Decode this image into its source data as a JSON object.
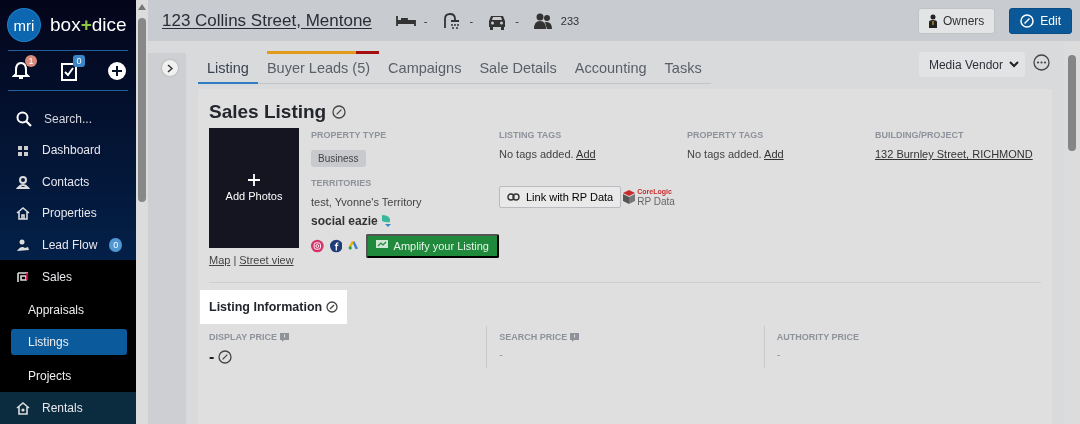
{
  "brand": {
    "logo": "mri",
    "before": "box",
    "joiner": "+",
    "after": "dice"
  },
  "quick_actions": [
    {
      "kind": "bell",
      "badge": "1"
    },
    {
      "kind": "tasks",
      "badge": "0"
    },
    {
      "kind": "add"
    }
  ],
  "search": {
    "placeholder": "Search..."
  },
  "nav": [
    {
      "kind": "dashboard",
      "label": "Dashboard",
      "selected": false
    },
    {
      "kind": "contacts",
      "label": "Contacts",
      "selected": false
    },
    {
      "kind": "properties",
      "label": "Properties",
      "selected": false
    },
    {
      "kind": "leadflow",
      "label": "Lead Flow",
      "badge": "0",
      "selected": false
    },
    {
      "kind": "sales",
      "label": "Sales",
      "selected": false,
      "expanded": true,
      "children": [
        {
          "label": "Appraisals",
          "selected": false
        },
        {
          "label": "Listings",
          "selected": true
        },
        {
          "label": "Projects",
          "selected": false
        }
      ]
    },
    {
      "kind": "rentals",
      "label": "Rentals",
      "selected": false
    }
  ],
  "header": {
    "address": "123 Collins Street, Mentone",
    "features": [
      {
        "kind": "bed",
        "value": "-"
      },
      {
        "kind": "bath",
        "value": "-"
      },
      {
        "kind": "car",
        "value": "-"
      },
      {
        "kind": "people",
        "value": "233"
      }
    ],
    "buttons": [
      {
        "kind": "owners",
        "label": "Owners"
      },
      {
        "kind": "edit",
        "label": "Edit"
      }
    ]
  },
  "tabs": [
    {
      "label": "Listing",
      "selected": true
    },
    {
      "label": "Buyer Leads (5)",
      "selected": false,
      "level": 0.79
    },
    {
      "label": "Campaigns",
      "selected": false
    },
    {
      "label": "Sale Details",
      "selected": false
    },
    {
      "label": "Accounting",
      "selected": false
    },
    {
      "label": "Tasks",
      "selected": false
    }
  ],
  "view_select": {
    "value": "Media Vendor"
  },
  "sales_listing": {
    "title": "Sales Listing",
    "photo": {
      "label": "Add Photos"
    },
    "links": {
      "map": "Map",
      "separator": "|",
      "street": "Street view"
    },
    "property_type": {
      "label": "PROPERTY TYPE",
      "value": "Business"
    },
    "territories": {
      "label": "TERRITORIES",
      "value": "test, Yvonne's Territory"
    },
    "listing_tags": {
      "label": "LISTING TAGS",
      "empty": "No tags added.",
      "action": "Add"
    },
    "rp_data": {
      "button": "Link with RP Data",
      "brand": "CoreLogic",
      "caption": "RP Data"
    },
    "property_tags": {
      "label": "PROPERTY TAGS",
      "empty": "No tags added.",
      "action": "Add"
    },
    "building": {
      "label": "BUILDING/PROJECT",
      "value": "132 Burnley Street, RICHMOND"
    },
    "social": {
      "brand": "social eazie",
      "channels": [
        {
          "kind": "instagram"
        },
        {
          "kind": "facebook"
        },
        {
          "kind": "google-ads"
        }
      ],
      "button": "Amplify your Listing"
    }
  },
  "listing_information": {
    "title": "Listing Information",
    "prices": [
      {
        "label": "DISPLAY PRICE",
        "note": true,
        "value": "-",
        "editable": true
      },
      {
        "label": "SEARCH PRICE",
        "note": true,
        "value": "-",
        "editable": false
      },
      {
        "label": "AUTHORITY PRICE",
        "note": false,
        "value": "-",
        "editable": false
      }
    ]
  }
}
